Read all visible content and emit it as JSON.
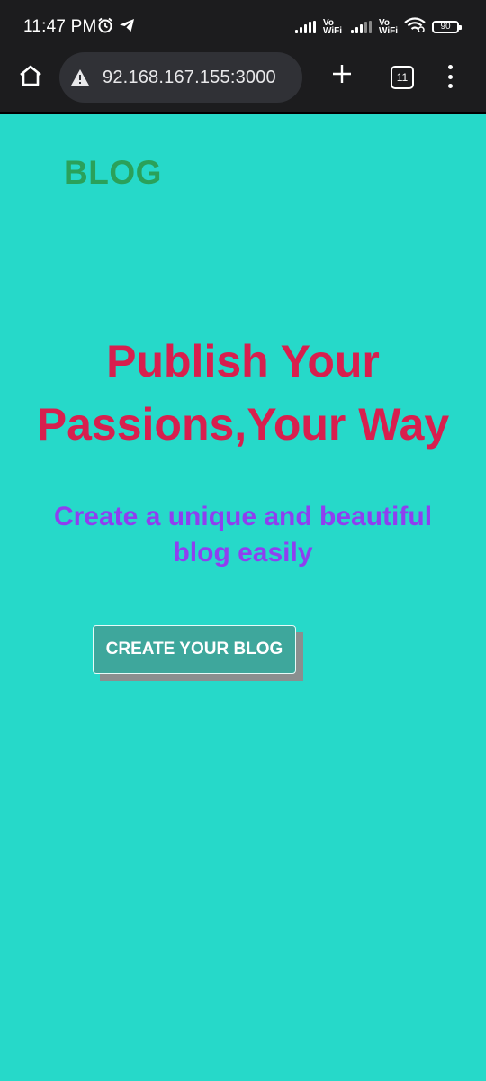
{
  "status_bar": {
    "time": "11:47 PM",
    "left_icons": [
      "alarm-icon",
      "telegram-icon"
    ],
    "vowifi_label_top": "Vo",
    "vowifi_label_bottom": "WiFi",
    "battery_level": "90"
  },
  "browser": {
    "url": "92.168.167.155:3000",
    "tab_count": "11",
    "icons": {
      "home": "home-icon",
      "warning": "not-secure-warning-icon",
      "new_tab": "plus-icon",
      "menu": "more-vert-icon"
    }
  },
  "page": {
    "logo": "BLOG",
    "hero_title_line1": "Publish Your",
    "hero_title_line2": "Passions,Your Way",
    "hero_subtitle_line1": "Create a unique and beautiful",
    "hero_subtitle_line2": "blog easily",
    "cta_label": "CREATE YOUR BLOG"
  },
  "colors": {
    "page_background": "#26d9c9",
    "chrome_background": "#1c1c1e",
    "logo": "#2aa15a",
    "hero_title": "#d81f4e",
    "hero_subtitle": "#8f3ff0",
    "cta_background": "#3ea79c"
  }
}
